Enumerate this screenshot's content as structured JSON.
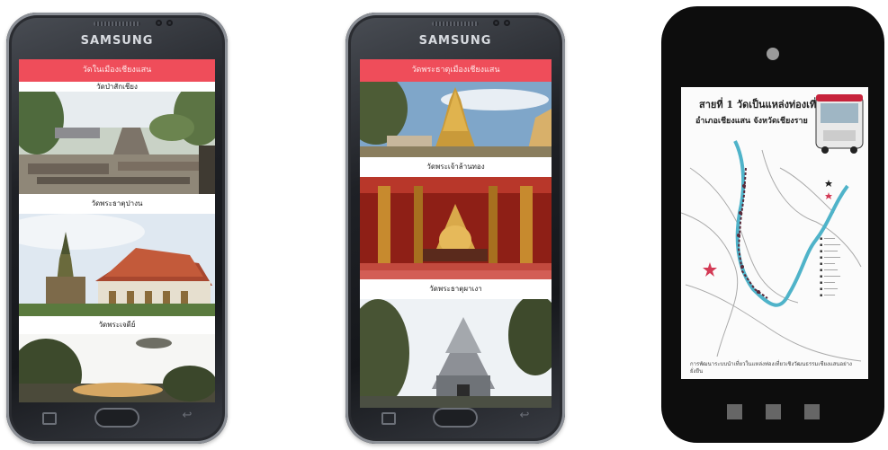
{
  "phone1": {
    "brand": "SAMSUNG",
    "header": "วัดในเมืองเชียงแสน",
    "captions": [
      "วัดป่าสักเชียง",
      "วัดพระธาตุปางน",
      "วัดพระเจดีย์"
    ]
  },
  "phone2": {
    "brand": "SAMSUNG",
    "header": "วัดพระธาตุเมืองเชียงแสน",
    "captions": [
      "วัดพระเจ้าล้านทอง",
      "วัดพระธาตุผาเงา"
    ]
  },
  "phone3": {
    "map_title": "สายที่ 1 วัดเป็นแหล่งท่องเที่ยว",
    "map_subtitle": "อำเภอเชียงแสน จังหวัดเชียงราย",
    "map_footer": "การพัฒนาระบบนำเที่ยวในแหล่งท่องเที่ยวเชิงวัฒนธรรมเชียงแสนอย่างยั่งยืน"
  },
  "colors": {
    "header_red": "#ef4d5a",
    "river_blue": "#4fb3c9",
    "star_red": "#d33a55"
  }
}
